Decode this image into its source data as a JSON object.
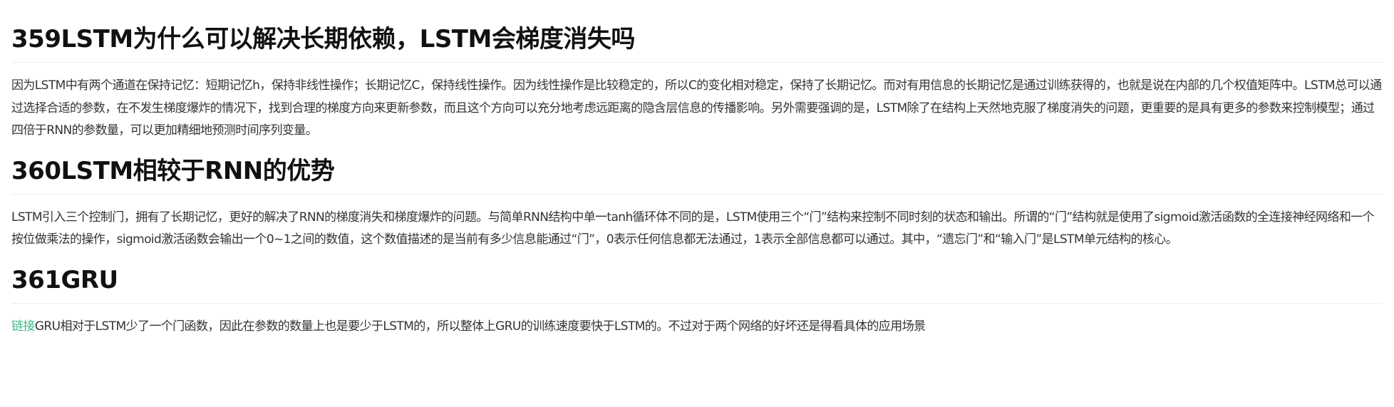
{
  "sections": [
    {
      "heading": "359LSTM为什么可以解决长期依赖，LSTM会梯度消失吗",
      "paragraph": "因为LSTM中有两个通道在保持记忆：短期记忆h，保持非线性操作；长期记忆C，保持线性操作。因为线性操作是比较稳定的，所以C的变化相对稳定，保持了长期记忆。而对有用信息的长期记忆是通过训练获得的，也就是说在内部的几个权值矩阵中。LSTM总可以通过选择合适的参数，在不发生梯度爆炸的情况下，找到合理的梯度方向来更新参数，而且这个方向可以充分地考虑远距离的隐含层信息的传播影响。另外需要强调的是，LSTM除了在结构上天然地克服了梯度消失的问题，更重要的是具有更多的参数来控制模型；通过四倍于RNN的参数量，可以更加精细地预测时间序列变量。"
    },
    {
      "heading": "360LSTM相较于RNN的优势",
      "paragraph": "LSTM引入三个控制门，拥有了长期记忆，更好的解决了RNN的梯度消失和梯度爆炸的问题。与简单RNN结构中单一tanh循环体不同的是，LSTM使用三个“门”结构来控制不同时刻的状态和输出。所谓的“门”结构就是使用了sigmoid激活函数的全连接神经网络和一个按位做乘法的操作，sigmoid激活函数会输出一个0~1之间的数值，这个数值描述的是当前有多少信息能通过“门”，0表示任何信息都无法通过，1表示全部信息都可以通过。其中，“遗忘门”和“输入门”是LSTM单元结构的核心。"
    },
    {
      "heading": "361GRU",
      "link_text": "链接",
      "paragraph": "GRU相对于LSTM少了一个门函数，因此在参数的数量上也是要少于LSTM的，所以整体上GRU的训练速度要快于LSTM的。不过对于两个网络的好坏还是得看具体的应用场景"
    }
  ],
  "colors": {
    "link": "#42b983",
    "heading": "#111111",
    "body_text": "#333333",
    "divider": "#eeeeee"
  }
}
